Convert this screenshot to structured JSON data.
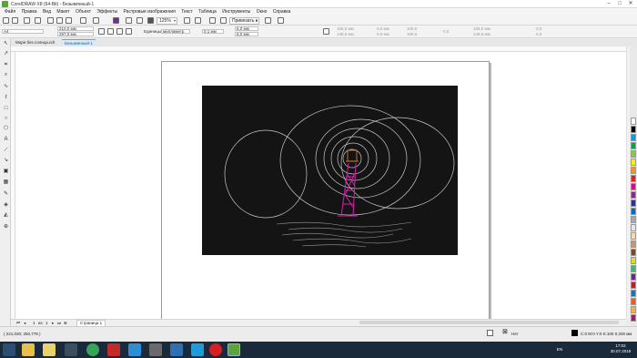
{
  "window": {
    "title": "CorelDRAW X8 (64-Bit) - Безымянный-1"
  },
  "menu": [
    "Файл",
    "Правка",
    "Вид",
    "Макет",
    "Объект",
    "Эффекты",
    "Растровые изображения",
    "Текст",
    "Таблица",
    "Инструменты",
    "Окно",
    "Справка"
  ],
  "toolbar": {
    "zoom": "125%",
    "snap": "Привязать к"
  },
  "properties": {
    "page_size": "A4",
    "width": "210,0 мм",
    "height": "297,0 мм",
    "units_label": "Единицы:",
    "units_value": "миллиметр",
    "nudge": "0,1 мм",
    "dup_x": "5,0 мм",
    "dup_y": "5,0 мм",
    "pos_x": "105,0 мм",
    "pos_y": "148,5 мм",
    "size_w": "0,0 мм",
    "size_h": "0,0 мм",
    "scale_x": "100,0",
    "scale_y": "100,0",
    "angle": "0,0",
    "center_x": "105,0 мм",
    "center_y": "148,5 мм",
    "right_a": "0,0",
    "right_b": "0,0"
  },
  "doc_tabs": [
    "Море без солнца.cdr",
    "Безымянный-1"
  ],
  "page_nav": {
    "current": "1",
    "of": "из",
    "total": "1",
    "tab": "Страница 1"
  },
  "status": {
    "coords": "( 221,030; 250,778 )",
    "fill_none": "Нет",
    "color_info": "C:0 M:0 Y:0 K:100  0,200 мм"
  },
  "taskbar": {
    "lang": "EN",
    "time": "17:02",
    "date": "30.07.2018"
  },
  "palette": [
    "#ffffff",
    "#000000",
    "#00a0e3",
    "#00a651",
    "#8dc63f",
    "#fff200",
    "#f7941d",
    "#ed1c24",
    "#ec008c",
    "#92278f",
    "#2e3192",
    "#0072bc",
    "#a7a9ac",
    "#e6e6e6",
    "#f9d9a6",
    "#c49a6c",
    "#754c24",
    "#d7df23",
    "#3cb878",
    "#662d91",
    "#be1e2d",
    "#1b75bc",
    "#f15a29",
    "#fbb040",
    "#9e1f63"
  ]
}
